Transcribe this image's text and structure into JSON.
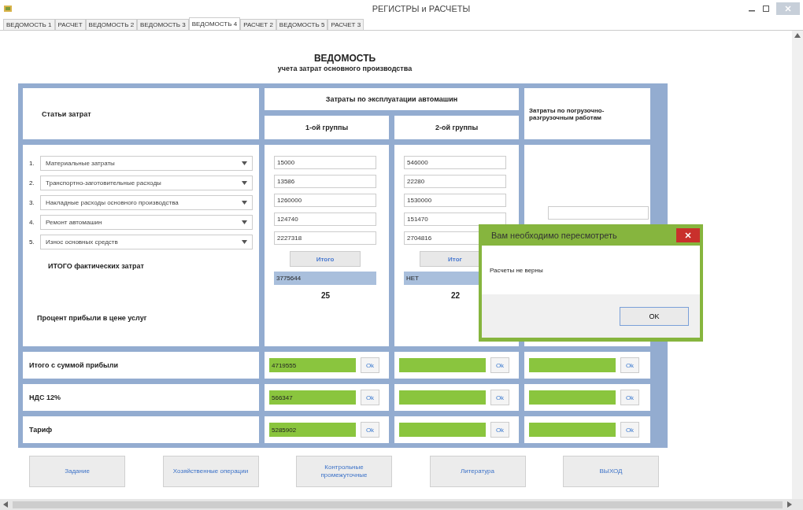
{
  "window": {
    "title": "РЕГИСТРЫ и РАСЧЕТЫ"
  },
  "tabs": [
    {
      "label": "ВЕДОМОСТЬ 1",
      "selected": false
    },
    {
      "label": "РАСЧЕТ",
      "selected": false
    },
    {
      "label": "ВЕДОМОСТЬ 2",
      "selected": false
    },
    {
      "label": "ВЕДОМОСТЬ 3",
      "selected": false
    },
    {
      "label": "ВЕДОМОСТЬ 4",
      "selected": true
    },
    {
      "label": "РАСЧЕТ 2",
      "selected": false
    },
    {
      "label": "ВЕДОМОСТЬ 5",
      "selected": false
    },
    {
      "label": "РАСЧЕТ 3",
      "selected": false
    }
  ],
  "heading": {
    "title": "ВЕДОМОСТЬ",
    "subtitle": "учета затрат основного производства"
  },
  "table": {
    "header_costs": "Статьи затрат",
    "header_vehicles": "Затраты по эксплуатации автомашин",
    "group_1": "1-ой группы",
    "group_2": "2-ой группы",
    "header_loading": "Затраты по погрузочно-разгрузочным работам",
    "items": [
      {
        "number": "1.",
        "name": "Материальные затраты",
        "group_1": "15000",
        "group_2": "546000"
      },
      {
        "number": "2.",
        "name": "Транспортно-заготовительные расходы",
        "group_1": "13586",
        "group_2": "22280"
      },
      {
        "number": "3.",
        "name": "Накладные расходы основного производства",
        "group_1": "1260000",
        "group_2": "1530000"
      },
      {
        "number": "4.",
        "name": "Ремонт автомашин",
        "group_1": "124740",
        "group_2": "151470"
      },
      {
        "number": "5.",
        "name": "Износ основных средств",
        "group_1": "2227318",
        "group_2": "2704816"
      }
    ],
    "total_label": "ИТОГО фактических затрат",
    "total_button_1": "Итого",
    "total_button_2": "Итог",
    "total_1": "3775644",
    "total_2": "НЕТ",
    "profit_label": "Процент прибыли в цене услуг",
    "profit_1": "25",
    "profit_2": "22",
    "summary_rows": [
      {
        "label": "Итого с суммой прибыли",
        "cells": [
          {
            "value": "4719555",
            "button": "Ok"
          },
          {
            "button": "Ok"
          },
          {
            "button": "Ok"
          }
        ]
      },
      {
        "label": "НДС 12%",
        "cells": [
          {
            "value": "566347",
            "button": "Ok"
          },
          {
            "button": "Ok"
          },
          {
            "button": "Ok"
          }
        ]
      },
      {
        "label": "Тариф",
        "cells": [
          {
            "value": "5285902",
            "button": "Ok"
          },
          {
            "button": "Ok"
          },
          {
            "button": "Ok"
          }
        ]
      }
    ]
  },
  "buttons": [
    "Задание",
    "Хозяйственные операции",
    "Контрольные промежуточные",
    "Литература",
    "ВЫХОД"
  ],
  "dialog": {
    "title": "Вам необходимо пересмотреть",
    "message": "Расчеты не верны",
    "button": "OK"
  }
}
